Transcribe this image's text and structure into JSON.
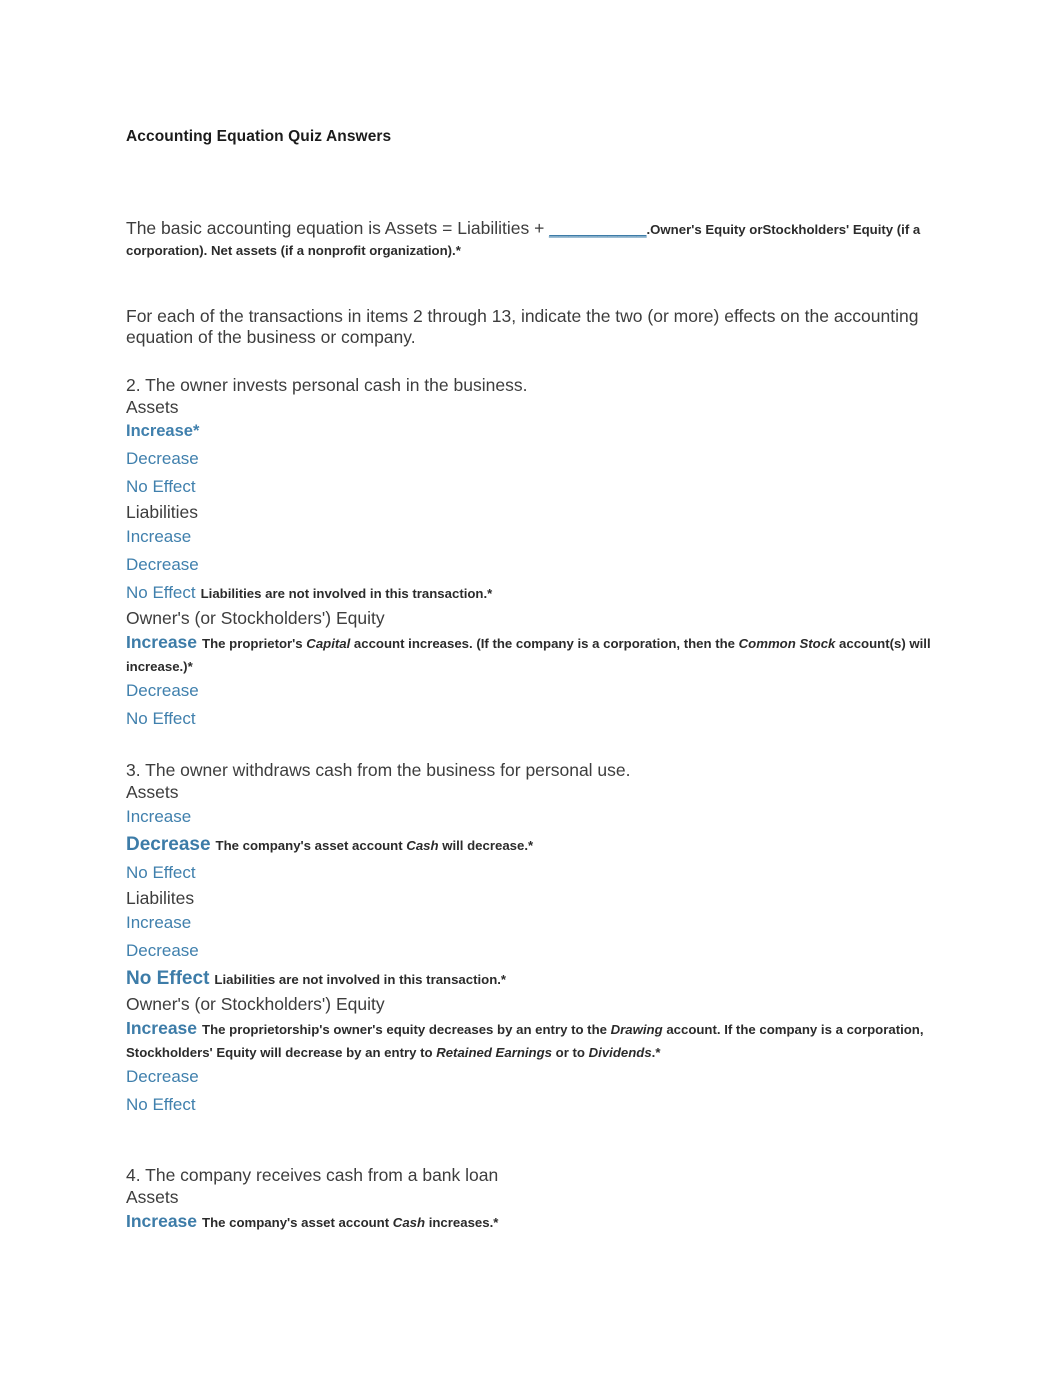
{
  "document": {
    "title": "Accounting Equation Quiz Answers",
    "intro_paragraph": "For each of the transactions in items 2 through 13, indicate the two (or more) effects on the accounting equation of the business or company."
  },
  "question_1": {
    "prompt": "The basic accounting equation is Assets = Liabilities + ",
    "blank": "__________",
    "answer_lead": ".",
    "answer_bold": "Owner's Equity orStockholders' Equity (if a corporation). Net assets (if a nonprofit organization).*"
  },
  "questions": [
    {
      "number": "2.",
      "text": "2. The owner invests personal cash in the business.",
      "groups": [
        {
          "label": "Assets",
          "options": [
            {
              "label": "Increase*",
              "style": "sel-sm",
              "note": ""
            },
            {
              "label": "Decrease",
              "style": "plain",
              "note": ""
            },
            {
              "label": "No Effect",
              "style": "plain",
              "note": ""
            }
          ]
        },
        {
          "label": "Liabilities",
          "options": [
            {
              "label": "Increase",
              "style": "plain",
              "note": ""
            },
            {
              "label": "Decrease",
              "style": "plain",
              "note": ""
            },
            {
              "label": "No Effect",
              "style": "plain",
              "note": "Liabilities are not involved in this transaction.*"
            }
          ]
        },
        {
          "label": "Owner's (or Stockholders') Equity",
          "options": [
            {
              "label": "Increase",
              "style": "sel-md",
              "note": "The proprietor's Capital account increases. (If the company is a corporation, then the Common Stock account(s) will increase.)*"
            },
            {
              "label": "Decrease",
              "style": "plain",
              "note": ""
            },
            {
              "label": "No Effect",
              "style": "plain",
              "note": ""
            }
          ]
        }
      ]
    },
    {
      "number": "3.",
      "text": "3. The owner withdraws cash from the business for personal use.",
      "groups": [
        {
          "label": "Assets",
          "options": [
            {
              "label": "Increase",
              "style": "plain",
              "note": ""
            },
            {
              "label": "Decrease",
              "style": "sel-lg",
              "note": "The company's asset account Cash will decrease.*"
            },
            {
              "label": "No Effect",
              "style": "plain",
              "note": ""
            }
          ]
        },
        {
          "label": "Liabilites",
          "options": [
            {
              "label": "Increase",
              "style": "plain",
              "note": ""
            },
            {
              "label": "Decrease",
              "style": "plain",
              "note": ""
            },
            {
              "label": "No Effect",
              "style": "sel-lg",
              "note": "Liabilities are not involved in this transaction.*"
            }
          ]
        },
        {
          "label": "Owner's (or Stockholders') Equity",
          "options": [
            {
              "label": "Increase",
              "style": "sel-md",
              "note": "The proprietorship's owner's equity decreases by an entry to the Drawing account. If the company is a corporation, Stockholders' Equity will decrease by an entry to Retained Earnings or to Dividends.*"
            },
            {
              "label": "Decrease",
              "style": "plain",
              "note": ""
            },
            {
              "label": "No Effect",
              "style": "plain",
              "note": ""
            }
          ]
        }
      ]
    },
    {
      "number": "4.",
      "text": "4. The company receives cash from a bank loan",
      "groups": [
        {
          "label": "Assets",
          "options": [
            {
              "label": "Increase",
              "style": "sel-md",
              "note": "The company's asset account Cash increases.*"
            }
          ]
        }
      ]
    }
  ],
  "colors": {
    "link_blue": "#4080ad",
    "selected_blue": "#3d7ca8",
    "body_text": "#3d3d3d",
    "note_text": "#2b2b2b",
    "title_text": "#1b1b1b",
    "page_background": "#ffffff"
  }
}
